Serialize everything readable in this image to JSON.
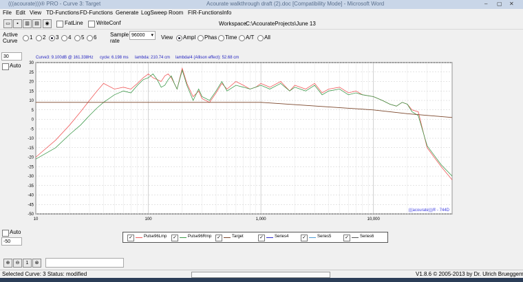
{
  "window": {
    "title": "(((acourate)))® PRO - Curve 3: Target",
    "center_title": "Acourate walkthrough draft (2).doc [Compatibility Mode] - Microsoft Word",
    "controls": [
      "–",
      "▢",
      "✕"
    ]
  },
  "menu": [
    "File",
    "Edit",
    "View",
    "TD-Functions",
    "FD-Functions",
    "Generate",
    "LogSweep",
    "Room",
    "FIR-Functions",
    "Info"
  ],
  "toolbar": {
    "icons": [
      "open-icon",
      "save-icon",
      "delete-icon",
      "print-icon",
      "camera-icon"
    ],
    "fatline": "FatLine",
    "writeconf": "WriteConf",
    "workspace_label": "Workspace:",
    "workspace_value": "C:\\AcourateProjects\\June 13"
  },
  "active_curve": {
    "label1": "Active",
    "label2": "Curve",
    "options": [
      "1",
      "2",
      "3",
      "4",
      "5",
      "6"
    ],
    "selected": "3"
  },
  "sample_rate": {
    "label1": "Sample",
    "label2": "rate",
    "value": "96000"
  },
  "view": {
    "label": "View",
    "options": [
      "Ampl",
      "Phas",
      "Time",
      "A/T",
      "All"
    ],
    "selected": "Ampl"
  },
  "left_panel": {
    "top_value": "30",
    "auto_label": "Auto",
    "bottom_auto_label": "Auto",
    "bottom_value": "-50"
  },
  "info": {
    "curve": "Curve3: 9.100dB @ 161.338Hz",
    "cycle": "cycle: 6.198 ms",
    "lambda": "lambda: 210.74 cm",
    "lambda4": "lambda/4 (Allison effect): 52.68 cm"
  },
  "watermark": "(((acourate)))® - 744D",
  "chart_data": {
    "type": "line",
    "x_scale": "log",
    "xlim": [
      10,
      50000
    ],
    "ylim": [
      -50,
      30
    ],
    "x_ticks": [
      10,
      100,
      1000,
      10000
    ],
    "x_tick_labels": [
      "10",
      "100",
      "1,000",
      "10,000"
    ],
    "y_ticks": [
      30,
      25,
      20,
      15,
      10,
      5,
      0,
      -5,
      -10,
      -15,
      -20,
      -25,
      -30,
      -35,
      -40,
      -45,
      -50
    ],
    "grid": true,
    "legend_position": "bottom",
    "series": [
      {
        "name": "Pulse96Lmp",
        "color": "#f05a5a",
        "x": [
          10,
          15,
          20,
          25,
          30,
          35,
          40,
          50,
          60,
          70,
          80,
          90,
          100,
          110,
          120,
          130,
          140,
          150,
          160,
          170,
          180,
          200,
          220,
          250,
          280,
          300,
          350,
          400,
          450,
          500,
          600,
          700,
          800,
          900,
          1000,
          1200,
          1500,
          1800,
          2000,
          2500,
          3000,
          3500,
          4000,
          5000,
          6000,
          7000,
          8000,
          10000,
          12000,
          14000,
          16000,
          18000,
          20000,
          22000,
          25000,
          30000,
          40000,
          50000
        ],
        "y": [
          -20,
          -11,
          -3,
          4,
          10,
          15,
          19,
          16,
          17,
          16,
          19,
          22,
          24,
          22,
          21,
          20,
          23,
          24,
          22,
          19,
          16,
          27,
          19,
          12,
          15,
          11,
          9,
          14,
          19,
          16,
          20,
          18,
          16,
          17,
          19,
          17,
          20,
          15,
          18,
          16,
          19,
          14,
          16,
          17,
          14,
          15,
          13,
          12,
          10,
          8,
          7,
          9,
          8,
          5,
          4,
          -15,
          -25,
          -32
        ]
      },
      {
        "name": "Pulse96Rmp",
        "color": "#3f9a4c",
        "x": [
          10,
          15,
          20,
          25,
          30,
          35,
          40,
          50,
          60,
          70,
          80,
          90,
          100,
          110,
          120,
          130,
          140,
          150,
          160,
          170,
          180,
          200,
          220,
          250,
          280,
          300,
          350,
          400,
          450,
          500,
          600,
          700,
          800,
          900,
          1000,
          1200,
          1500,
          1800,
          2000,
          2500,
          3000,
          3500,
          4000,
          5000,
          6000,
          7000,
          8000,
          10000,
          12000,
          14000,
          16000,
          18000,
          20000,
          22000,
          25000,
          30000,
          40000,
          50000
        ],
        "y": [
          -21,
          -15,
          -8,
          -3,
          2,
          6,
          9,
          13,
          15,
          14,
          18,
          21,
          22,
          24,
          21,
          17,
          18,
          21,
          23,
          19,
          16,
          26,
          18,
          10,
          16,
          12,
          10,
          15,
          20,
          15,
          18,
          17,
          16,
          17,
          18,
          16,
          19,
          15,
          17,
          15,
          18,
          13,
          15,
          16,
          13,
          14,
          13,
          12,
          10,
          8,
          7,
          9,
          8,
          4,
          2,
          -14,
          -24,
          -30
        ]
      },
      {
        "name": "Target",
        "color": "#7a4428",
        "x": [
          10,
          100,
          1000,
          10000,
          20000,
          50000
        ],
        "y": [
          9,
          9,
          9,
          5,
          3,
          1
        ]
      },
      {
        "name": "Series4",
        "color": "#2b2bd0",
        "x": [],
        "y": []
      },
      {
        "name": "Series5",
        "color": "#4d9dd6",
        "x": [],
        "y": []
      },
      {
        "name": "Series6",
        "color": "#555555",
        "x": [],
        "y": []
      }
    ]
  },
  "zoom_buttons": [
    "zoom-in-icon",
    "zoom-out-icon",
    "1",
    "reset-icon"
  ],
  "status": {
    "left": "Selected Curve: 3  Status: modified",
    "right": "V1.8.6 © 2005-2013 by Dr. Ulrich Brueggemann"
  }
}
